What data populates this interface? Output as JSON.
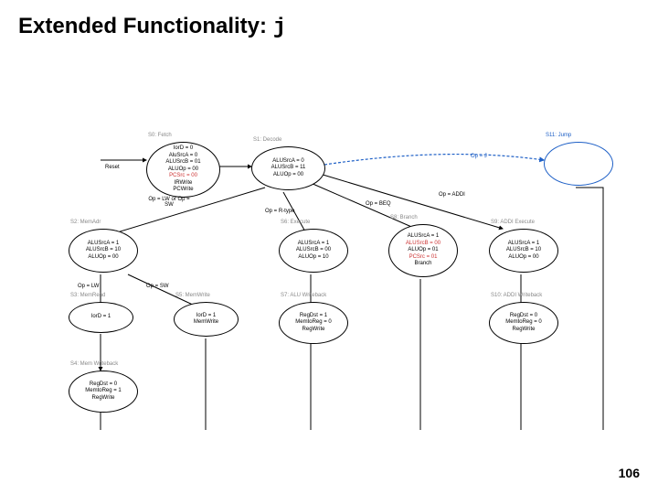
{
  "title_prefix": "Extended Functionality: ",
  "title_code": "j",
  "page_number": "106",
  "states": {
    "s0": {
      "label": "S0: Fetch",
      "lines": [
        "IorD = 0",
        "AluSrcA = 0",
        "ALUSrcB = 01",
        "ALUOp = 00",
        "PCSrc = 00",
        "IRWrite",
        "PCWrite"
      ]
    },
    "s1": {
      "label": "S1: Decode",
      "lines": [
        "ALUSrcA = 0",
        "ALUSrcB = 11",
        "ALUOp = 00"
      ]
    },
    "s2": {
      "label": "S2: MemAdr",
      "lines": [
        "ALUSrcA = 1",
        "ALUSrcB = 10",
        "ALUOp = 00"
      ]
    },
    "s3": {
      "label": "S3: MemRead",
      "lines": [
        "IorD = 1"
      ]
    },
    "s4": {
      "label": "S4: Mem Writeback",
      "lines": [
        "RegDst = 0",
        "MemtoReg = 1",
        "RegWrite"
      ]
    },
    "s5": {
      "label": "S5: MemWrite",
      "lines": [
        "IorD = 1",
        "MemWrite"
      ]
    },
    "s6": {
      "label": "S6: Execute",
      "lines": [
        "ALUSrcA = 1",
        "ALUSrcB = 00",
        "ALUOp = 10"
      ]
    },
    "s7": {
      "label": "S7: ALU Writeback",
      "lines": [
        "RegDst = 1",
        "MemtoReg = 0",
        "RegWrite"
      ]
    },
    "s8": {
      "label": "S8: Branch",
      "lines": [
        "ALUSrcA = 1",
        "ALUSrcB = 00",
        "ALUOp = 01",
        "PCSrc = 01",
        "Branch"
      ]
    },
    "s9": {
      "label": "S9: ADDI Execute",
      "lines": [
        "ALUSrcA = 1",
        "ALUSrcB = 10",
        "ALUOp = 00"
      ]
    },
    "s10": {
      "label": "S10: ADDI Writeback",
      "lines": [
        "RegDst = 0",
        "MemtoReg = 0",
        "RegWrite"
      ]
    },
    "s11": {
      "label": "S11: Jump",
      "lines": [
        ""
      ]
    }
  },
  "edges": {
    "reset": "Reset",
    "op_lw_sw": "Op = LW\nor\nOp = SW",
    "op_rtype": "Op = R-type",
    "op_beq": "Op = BEQ",
    "op_addi": "Op = ADDI",
    "op_j": "Op = J",
    "op_lw": "Op = LW",
    "op_sw": "Op = SW"
  }
}
